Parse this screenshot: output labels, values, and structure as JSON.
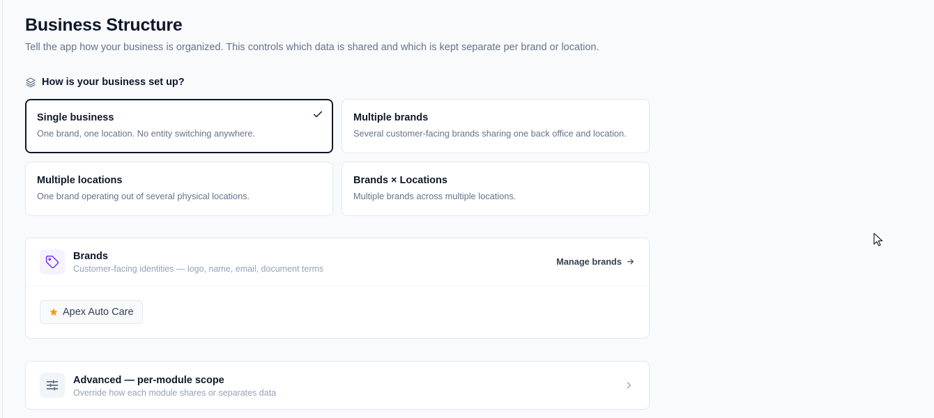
{
  "header": {
    "title": "Business Structure",
    "subtitle": "Tell the app how your business is organized. This controls which data is shared and which is kept separate per brand or location."
  },
  "setup": {
    "question": "How is your business set up?",
    "options": [
      {
        "title": "Single business",
        "description": "One brand, one location. No entity switching anywhere.",
        "selected": true
      },
      {
        "title": "Multiple brands",
        "description": "Several customer-facing brands sharing one back office and location.",
        "selected": false
      },
      {
        "title": "Multiple locations",
        "description": "One brand operating out of several physical locations.",
        "selected": false
      },
      {
        "title": "Brands × Locations",
        "description": "Multiple brands across multiple locations.",
        "selected": false
      }
    ]
  },
  "brands": {
    "title": "Brands",
    "subtitle": "Customer-facing identities — logo, name, email, document terms",
    "manage_label": "Manage brands",
    "items": [
      {
        "name": "Apex Auto Care",
        "primary": true
      }
    ]
  },
  "advanced": {
    "title": "Advanced — per-module scope",
    "subtitle": "Override how each module shares or separates data"
  },
  "colors": {
    "accent_purple": "#7c3aed",
    "star_amber": "#f59e0b",
    "selected_border": "#0f172a"
  },
  "icons": {
    "section": "layers-icon",
    "selected": "check-icon",
    "brands": "tag-icon",
    "manage": "arrow-right-icon",
    "primary_brand": "star-icon",
    "advanced": "sliders-icon",
    "advanced_open": "chevron-right-icon"
  }
}
